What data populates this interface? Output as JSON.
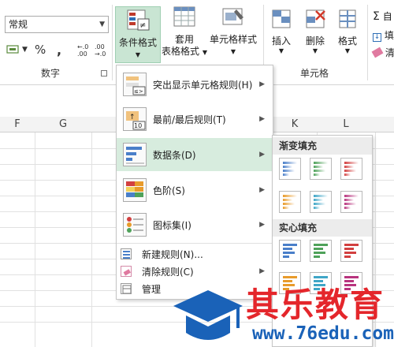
{
  "ribbon": {
    "number_format_value": "常规",
    "percent_symbol": "%",
    "comma_symbol": ",",
    "increase_decimal": ".00→.0",
    "decrease_decimal": ".00→.0",
    "number_group_label": "数字",
    "conditional_format_label": "条件格式",
    "table_format_line1": "套用",
    "table_format_line2": "表格格式",
    "cell_styles_label": "单元格样式",
    "insert_label": "插入",
    "delete_label": "删除",
    "format_label": "格式",
    "cells_group_label": "单元格",
    "edge_item_1": "自",
    "edge_item_2": "填",
    "edge_item_3": "清"
  },
  "sheet": {
    "columns": [
      {
        "name": "F"
      },
      {
        "name": "G"
      },
      {
        "name": "K"
      },
      {
        "name": "L"
      }
    ]
  },
  "menu": {
    "items": [
      {
        "label": "突出显示单元格规则(H)"
      },
      {
        "label": "最前/最后规则(T)"
      },
      {
        "label": "数据条(D)"
      },
      {
        "label": "色阶(S)"
      },
      {
        "label": "图标集(I)"
      },
      {
        "label": "新建规则(N)..."
      },
      {
        "label": "清除规则(C)"
      },
      {
        "label": "管理"
      }
    ],
    "icon_badge_text": "10",
    "icon_badge_small": "≤>"
  },
  "submenu": {
    "gradient_title": "渐变填充",
    "solid_title": "实心填充"
  },
  "watermark": {
    "text": "其乐教育",
    "url": "www.76edu.com"
  },
  "colors": {
    "accent_green": "#d7ecde",
    "blue": "#4a7fc9",
    "green": "#4fa25a",
    "red": "#d24040",
    "orange": "#e89b2b",
    "cyan": "#3fa6c7",
    "magenta": "#b8347e",
    "watermark_red": "#e4262b",
    "watermark_blue": "#1a62b8"
  }
}
